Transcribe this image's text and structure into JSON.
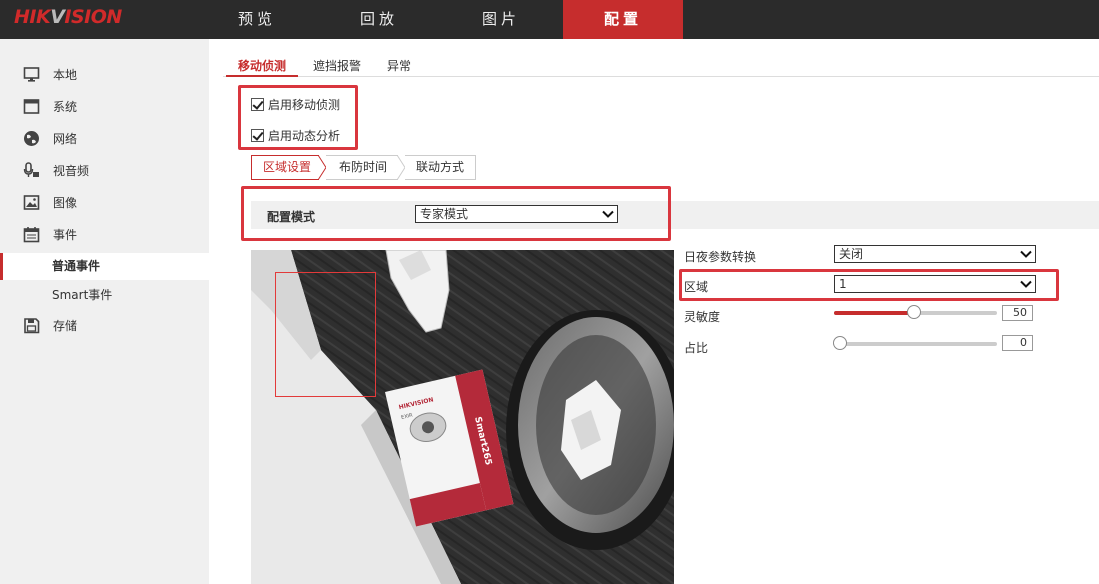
{
  "brand": {
    "logo_left": "HIK",
    "logo_v": "V",
    "logo_right": "ISION"
  },
  "nav": {
    "tabs": [
      "预览",
      "回放",
      "图片",
      "配置"
    ],
    "active": "配置"
  },
  "sidebar": {
    "items": [
      {
        "label": "本地",
        "icon": "monitor-icon"
      },
      {
        "label": "系统",
        "icon": "window-icon"
      },
      {
        "label": "网络",
        "icon": "globe-icon"
      },
      {
        "label": "视音频",
        "icon": "audio-video-icon"
      },
      {
        "label": "图像",
        "icon": "image-icon"
      },
      {
        "label": "事件",
        "icon": "calendar-icon"
      },
      {
        "label": "存储",
        "icon": "floppy-icon"
      }
    ],
    "sub_items": [
      "普通事件",
      "Smart事件"
    ],
    "active_sub": "普通事件"
  },
  "main": {
    "tabs": [
      "移动侦测",
      "遮挡报警",
      "异常"
    ],
    "active_tab": "移动侦测",
    "checkboxes": [
      {
        "label": "启用移动侦测",
        "checked": true
      },
      {
        "label": "启用动态分析",
        "checked": true
      }
    ],
    "steps": [
      "区域设置",
      "布防时间",
      "联动方式"
    ],
    "active_step": "区域设置",
    "mode_label": "配置模式",
    "mode_value": "专家模式"
  },
  "params": {
    "day_night_label": "日夜参数转换",
    "day_night_value": "关闭",
    "region_label": "区域",
    "region_value": "1",
    "sensitivity_label": "灵敏度",
    "sensitivity_value": "50",
    "ratio_label": "占比",
    "ratio_value": "0"
  },
  "box_text": {
    "brand": "HIKVISION",
    "product": "Smart265",
    "sub": "EXIR"
  },
  "colors": {
    "accent": "#c62d2d",
    "highlight": "#d9363e",
    "topbar": "#2b2b2b",
    "sidebar": "#f0f0f0"
  }
}
